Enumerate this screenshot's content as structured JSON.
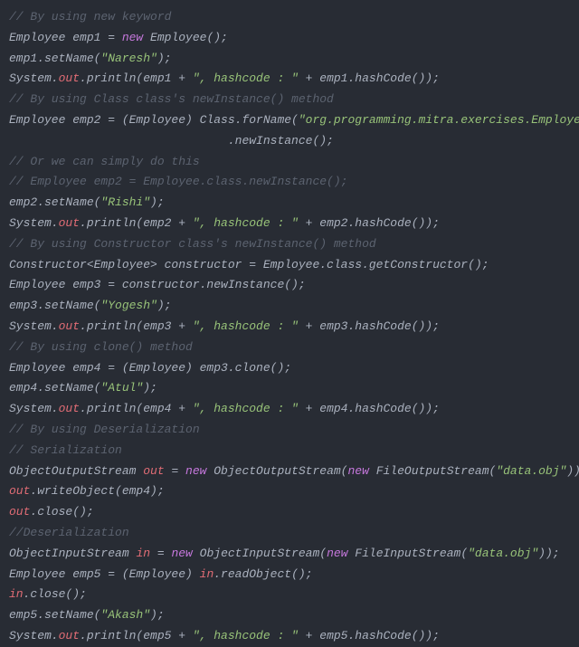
{
  "code": {
    "lines": [
      {
        "type": "comment",
        "tokens": [
          {
            "t": "// By using new keyword",
            "c": "comment"
          }
        ]
      },
      {
        "type": "code",
        "tokens": [
          {
            "t": "Employee emp1 = ",
            "c": "default"
          },
          {
            "t": "new",
            "c": "keyword"
          },
          {
            "t": " Employee();",
            "c": "default"
          }
        ]
      },
      {
        "type": "code",
        "tokens": [
          {
            "t": "emp1.setName(",
            "c": "default"
          },
          {
            "t": "\"Naresh\"",
            "c": "string"
          },
          {
            "t": ");",
            "c": "default"
          }
        ]
      },
      {
        "type": "code",
        "tokens": [
          {
            "t": "System.",
            "c": "default"
          },
          {
            "t": "out",
            "c": "field"
          },
          {
            "t": ".println(emp1 + ",
            "c": "default"
          },
          {
            "t": "\", hashcode : \"",
            "c": "string"
          },
          {
            "t": " + emp1.hashCode());",
            "c": "default"
          }
        ]
      },
      {
        "type": "comment",
        "tokens": [
          {
            "t": "// By using Class class's newInstance() method",
            "c": "comment"
          }
        ]
      },
      {
        "type": "code",
        "tokens": [
          {
            "t": "Employee emp2 = (Employee) Class.forName(",
            "c": "default"
          },
          {
            "t": "\"org.programming.mitra.exercises.Employee\"",
            "c": "string"
          },
          {
            "t": ")",
            "c": "default"
          }
        ]
      },
      {
        "type": "code",
        "tokens": [
          {
            "t": "                               .newInstance();",
            "c": "default"
          }
        ]
      },
      {
        "type": "comment",
        "tokens": [
          {
            "t": "// Or we can simply do this",
            "c": "comment"
          }
        ]
      },
      {
        "type": "comment",
        "tokens": [
          {
            "t": "// Employee emp2 = Employee.class.newInstance();",
            "c": "comment"
          }
        ]
      },
      {
        "type": "code",
        "tokens": [
          {
            "t": "emp2.setName(",
            "c": "default"
          },
          {
            "t": "\"Rishi\"",
            "c": "string"
          },
          {
            "t": ");",
            "c": "default"
          }
        ]
      },
      {
        "type": "code",
        "tokens": [
          {
            "t": "System.",
            "c": "default"
          },
          {
            "t": "out",
            "c": "field"
          },
          {
            "t": ".println(emp2 + ",
            "c": "default"
          },
          {
            "t": "\", hashcode : \"",
            "c": "string"
          },
          {
            "t": " + emp2.hashCode());",
            "c": "default"
          }
        ]
      },
      {
        "type": "comment",
        "tokens": [
          {
            "t": "// By using Constructor class's newInstance() method",
            "c": "comment"
          }
        ]
      },
      {
        "type": "code",
        "tokens": [
          {
            "t": "Constructor<Employee> constructor = Employee.class.getConstructor();",
            "c": "default"
          }
        ]
      },
      {
        "type": "code",
        "tokens": [
          {
            "t": "Employee emp3 = constructor.newInstance();",
            "c": "default"
          }
        ]
      },
      {
        "type": "code",
        "tokens": [
          {
            "t": "emp3.setName(",
            "c": "default"
          },
          {
            "t": "\"Yogesh\"",
            "c": "string"
          },
          {
            "t": ");",
            "c": "default"
          }
        ]
      },
      {
        "type": "code",
        "tokens": [
          {
            "t": "System.",
            "c": "default"
          },
          {
            "t": "out",
            "c": "field"
          },
          {
            "t": ".println(emp3 + ",
            "c": "default"
          },
          {
            "t": "\", hashcode : \"",
            "c": "string"
          },
          {
            "t": " + emp3.hashCode());",
            "c": "default"
          }
        ]
      },
      {
        "type": "comment",
        "tokens": [
          {
            "t": "// By using clone() method",
            "c": "comment"
          }
        ]
      },
      {
        "type": "code",
        "tokens": [
          {
            "t": "Employee emp4 = (Employee) emp3.clone();",
            "c": "default"
          }
        ]
      },
      {
        "type": "code",
        "tokens": [
          {
            "t": "emp4.setName(",
            "c": "default"
          },
          {
            "t": "\"Atul\"",
            "c": "string"
          },
          {
            "t": ");",
            "c": "default"
          }
        ]
      },
      {
        "type": "code",
        "tokens": [
          {
            "t": "System.",
            "c": "default"
          },
          {
            "t": "out",
            "c": "field"
          },
          {
            "t": ".println(emp4 + ",
            "c": "default"
          },
          {
            "t": "\", hashcode : \"",
            "c": "string"
          },
          {
            "t": " + emp4.hashCode());",
            "c": "default"
          }
        ]
      },
      {
        "type": "comment",
        "tokens": [
          {
            "t": "// By using Deserialization",
            "c": "comment"
          }
        ]
      },
      {
        "type": "comment",
        "tokens": [
          {
            "t": "// Serialization",
            "c": "comment"
          }
        ]
      },
      {
        "type": "code",
        "tokens": [
          {
            "t": "ObjectOutputStream ",
            "c": "default"
          },
          {
            "t": "out",
            "c": "field"
          },
          {
            "t": " = ",
            "c": "default"
          },
          {
            "t": "new",
            "c": "keyword"
          },
          {
            "t": " ObjectOutputStream(",
            "c": "default"
          },
          {
            "t": "new",
            "c": "keyword"
          },
          {
            "t": " FileOutputStream(",
            "c": "default"
          },
          {
            "t": "\"data.obj\"",
            "c": "string"
          },
          {
            "t": "));",
            "c": "default"
          }
        ]
      },
      {
        "type": "code",
        "tokens": [
          {
            "t": "out",
            "c": "field"
          },
          {
            "t": ".writeObject(emp4);",
            "c": "default"
          }
        ]
      },
      {
        "type": "code",
        "tokens": [
          {
            "t": "out",
            "c": "field"
          },
          {
            "t": ".close();",
            "c": "default"
          }
        ]
      },
      {
        "type": "comment",
        "tokens": [
          {
            "t": "//Deserialization",
            "c": "comment"
          }
        ]
      },
      {
        "type": "code",
        "tokens": [
          {
            "t": "ObjectInputStream ",
            "c": "default"
          },
          {
            "t": "in",
            "c": "field"
          },
          {
            "t": " = ",
            "c": "default"
          },
          {
            "t": "new",
            "c": "keyword"
          },
          {
            "t": " ObjectInputStream(",
            "c": "default"
          },
          {
            "t": "new",
            "c": "keyword"
          },
          {
            "t": " FileInputStream(",
            "c": "default"
          },
          {
            "t": "\"data.obj\"",
            "c": "string"
          },
          {
            "t": "));",
            "c": "default"
          }
        ]
      },
      {
        "type": "code",
        "tokens": [
          {
            "t": "Employee emp5 = (Employee) ",
            "c": "default"
          },
          {
            "t": "in",
            "c": "field"
          },
          {
            "t": ".readObject();",
            "c": "default"
          }
        ]
      },
      {
        "type": "code",
        "tokens": [
          {
            "t": "in",
            "c": "field"
          },
          {
            "t": ".close();",
            "c": "default"
          }
        ]
      },
      {
        "type": "code",
        "tokens": [
          {
            "t": "emp5.setName(",
            "c": "default"
          },
          {
            "t": "\"Akash\"",
            "c": "string"
          },
          {
            "t": ");",
            "c": "default"
          }
        ]
      },
      {
        "type": "code",
        "tokens": [
          {
            "t": "System.",
            "c": "default"
          },
          {
            "t": "out",
            "c": "field"
          },
          {
            "t": ".println(emp5 + ",
            "c": "default"
          },
          {
            "t": "\", hashcode : \"",
            "c": "string"
          },
          {
            "t": " + emp5.hashCode());",
            "c": "default"
          }
        ]
      }
    ]
  }
}
